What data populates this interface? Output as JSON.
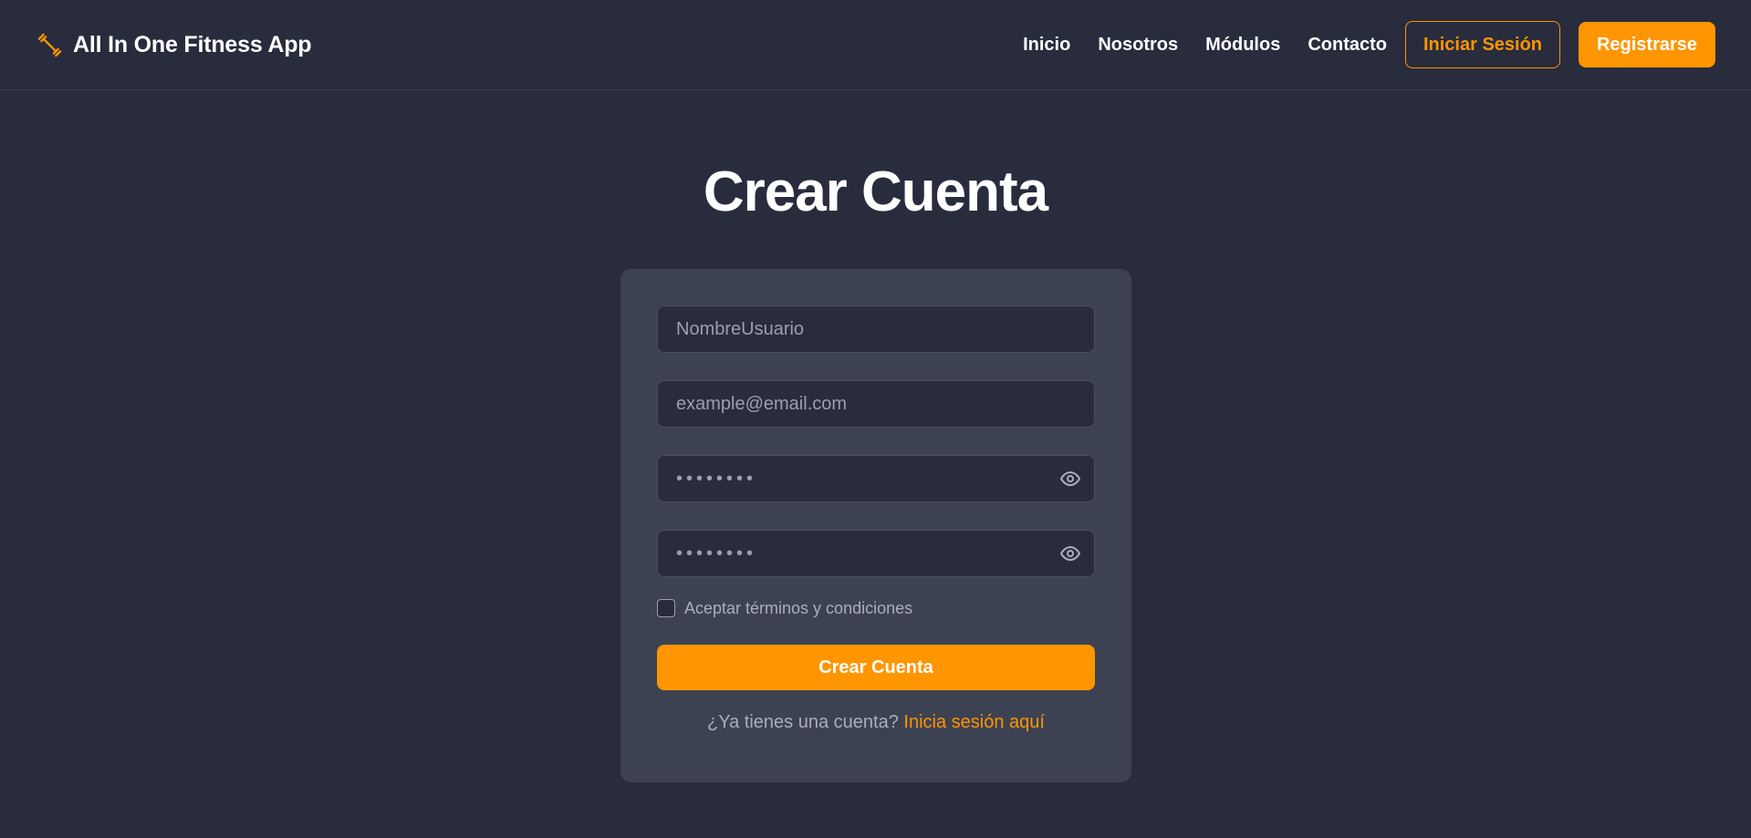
{
  "navbar": {
    "brand_icon": "dumbbell-icon",
    "brand_name": "All In One Fitness App",
    "links": [
      "Inicio",
      "Nosotros",
      "Módulos",
      "Contacto"
    ],
    "login_button": "Iniciar Sesión",
    "register_button": "Registrarse"
  },
  "main": {
    "title": "Crear Cuenta"
  },
  "form": {
    "username_placeholder": "NombreUsuario",
    "email_placeholder": "example@email.com",
    "password_value": "••••••••",
    "confirm_password_value": "••••••••",
    "eye_icon": "eye-icon",
    "terms_label": "Aceptar términos y condiciones",
    "terms_checked": false,
    "submit_label": "Crear Cuenta",
    "login_prompt": "¿Ya tienes una cuenta?",
    "login_link": "Inicia sesión aquí"
  },
  "colors": {
    "background": "#282c3d",
    "card": "#3d4253",
    "accent": "#ff9500",
    "text": "#ffffff",
    "muted_text": "#a9aebb"
  }
}
